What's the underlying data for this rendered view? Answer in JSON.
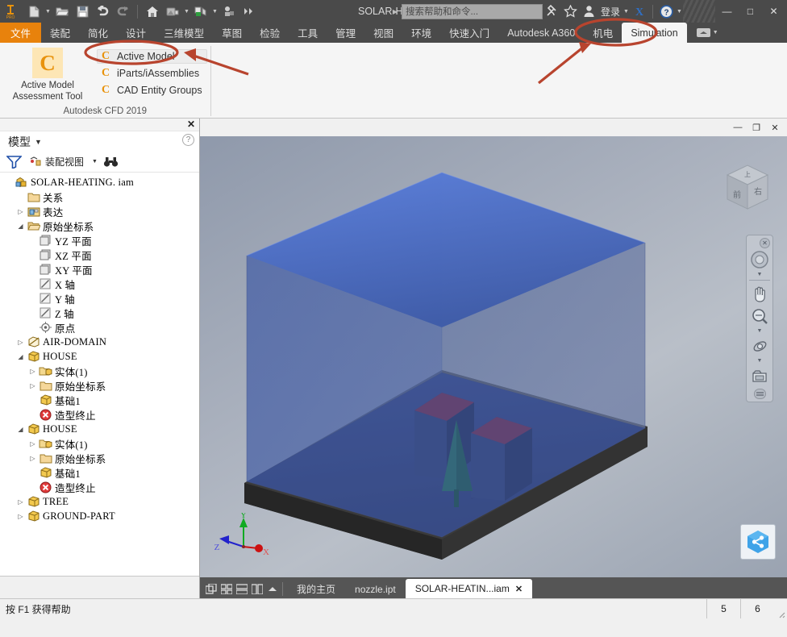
{
  "titlebar": {
    "doc_title": "SOLAR-HEAT...",
    "search_placeholder": "搜索帮助和命令...",
    "signin_label": "登录",
    "quick_access": [
      {
        "name": "new-file-icon",
        "label": "新建"
      },
      {
        "name": "open-file-icon",
        "label": "打开"
      },
      {
        "name": "save-icon",
        "label": "保存"
      },
      {
        "name": "undo-icon",
        "label": "放弃"
      },
      {
        "name": "redo-icon",
        "label": "重做"
      },
      {
        "name": "home-icon",
        "label": "主页"
      },
      {
        "name": "appearance-icon",
        "label": "外观"
      },
      {
        "name": "material-icon",
        "label": "材料"
      },
      {
        "name": "update-icon",
        "label": "更新"
      },
      {
        "name": "more-icon",
        "label": "更多"
      }
    ],
    "window_controls": {
      "minimize": "—",
      "maximize": "□",
      "close": "✕"
    },
    "exchange_icon": "X",
    "help_icon": "?"
  },
  "ribbon_tabs": [
    {
      "label": "文件",
      "state": "file"
    },
    {
      "label": "装配",
      "state": "normal"
    },
    {
      "label": "简化",
      "state": "normal"
    },
    {
      "label": "设计",
      "state": "normal"
    },
    {
      "label": "三维模型",
      "state": "normal"
    },
    {
      "label": "草图",
      "state": "normal"
    },
    {
      "label": "检验",
      "state": "normal"
    },
    {
      "label": "工具",
      "state": "normal"
    },
    {
      "label": "管理",
      "state": "normal"
    },
    {
      "label": "视图",
      "state": "normal"
    },
    {
      "label": "环境",
      "state": "normal"
    },
    {
      "label": "快速入门",
      "state": "normal"
    },
    {
      "label": "Autodesk A360",
      "state": "normal"
    },
    {
      "label": "机电",
      "state": "normal"
    },
    {
      "label": "Simulation",
      "state": "active"
    }
  ],
  "ribbon_panel": {
    "panel_label": "Autodesk CFD 2019",
    "big_button": {
      "icon_glyph": "C",
      "line1": "Active Model",
      "line2": "Assessment Tool"
    },
    "items": [
      {
        "icon_glyph": "C",
        "label": "Active Model",
        "highlighted": true
      },
      {
        "icon_glyph": "C",
        "label": "iParts/iAssemblies",
        "highlighted": false
      },
      {
        "icon_glyph": "C",
        "label": "CAD Entity Groups",
        "highlighted": false
      }
    ]
  },
  "browser": {
    "title": "模型",
    "close_icon": "✕",
    "help_icon": "?",
    "toolbar": {
      "filter_icon": "filter-icon",
      "view_label": "装配视图",
      "search_icon": "binoculars-icon"
    },
    "tree": [
      {
        "label": "SOLAR-HEATING. iam",
        "indent": 0,
        "expander": "none",
        "icon": "assembly"
      },
      {
        "label": "关系",
        "indent": 1,
        "expander": "none",
        "icon": "folder"
      },
      {
        "label": "表达",
        "indent": 1,
        "expander": "collapsed",
        "icon": "rep"
      },
      {
        "label": "原始坐标系",
        "indent": 1,
        "expander": "expanded",
        "icon": "folder-open"
      },
      {
        "label": "YZ 平面",
        "indent": 2,
        "expander": "none",
        "icon": "plane"
      },
      {
        "label": "XZ 平面",
        "indent": 2,
        "expander": "none",
        "icon": "plane"
      },
      {
        "label": "XY 平面",
        "indent": 2,
        "expander": "none",
        "icon": "plane"
      },
      {
        "label": "X 轴",
        "indent": 2,
        "expander": "none",
        "icon": "axis"
      },
      {
        "label": "Y 轴",
        "indent": 2,
        "expander": "none",
        "icon": "axis"
      },
      {
        "label": "Z 轴",
        "indent": 2,
        "expander": "none",
        "icon": "axis"
      },
      {
        "label": "原点",
        "indent": 2,
        "expander": "none",
        "icon": "point"
      },
      {
        "label": "AIR-DOMAIN",
        "indent": 1,
        "expander": "collapsed",
        "icon": "ghost-part"
      },
      {
        "label": "HOUSE",
        "indent": 1,
        "expander": "expanded",
        "icon": "part"
      },
      {
        "label": "实体(1)",
        "indent": 2,
        "expander": "collapsed",
        "icon": "solids"
      },
      {
        "label": "原始坐标系",
        "indent": 2,
        "expander": "collapsed",
        "icon": "folder"
      },
      {
        "label": "基础1",
        "indent": 2,
        "expander": "none",
        "icon": "part"
      },
      {
        "label": "造型终止",
        "indent": 2,
        "expander": "none",
        "icon": "end-of-part"
      },
      {
        "label": "HOUSE",
        "indent": 1,
        "expander": "expanded",
        "icon": "part"
      },
      {
        "label": "实体(1)",
        "indent": 2,
        "expander": "collapsed",
        "icon": "solids"
      },
      {
        "label": "原始坐标系",
        "indent": 2,
        "expander": "collapsed",
        "icon": "folder"
      },
      {
        "label": "基础1",
        "indent": 2,
        "expander": "none",
        "icon": "part"
      },
      {
        "label": "造型终止",
        "indent": 2,
        "expander": "none",
        "icon": "end-of-part"
      },
      {
        "label": "TREE",
        "indent": 1,
        "expander": "collapsed",
        "icon": "part"
      },
      {
        "label": "GROUND-PART",
        "indent": 1,
        "expander": "collapsed",
        "icon": "part"
      }
    ]
  },
  "viewport": {
    "window_controls": {
      "minimize": "—",
      "restore": "❐",
      "close": "✕"
    },
    "viewcube": {
      "front_face": "前",
      "right_face": "右",
      "top_face": "上"
    },
    "axis_indicator": {
      "x": "X",
      "y": "Y",
      "z": "Z",
      "x_color": "#cc1111",
      "y_color": "#11aa22",
      "z_color": "#2222cc"
    },
    "navbar": [
      {
        "name": "steering-wheel-icon"
      },
      {
        "name": "pan-hand-icon"
      },
      {
        "name": "zoom-magnifier-icon"
      },
      {
        "name": "orbit-icon"
      },
      {
        "name": "look-at-icon"
      }
    ],
    "a360_icon": "share-icon",
    "model_colors": {
      "air_domain": "#4a63a8",
      "air_domain_top": "#4f72c9",
      "roof": "#6e3558",
      "house_wall": "#34437a",
      "tree": "#2b6b64",
      "ground_slab": "#3a3a3a"
    }
  },
  "doc_tabs": {
    "layout_icons": [
      "cascade-icon",
      "tile-icon",
      "horizontal-icon",
      "vertical-icon",
      "collapse-icon"
    ],
    "tabs": [
      {
        "label": "我的主页",
        "active": false,
        "closable": false
      },
      {
        "label": "nozzle.ipt",
        "active": false,
        "closable": false
      },
      {
        "label": "SOLAR-HEATIN...iam",
        "active": true,
        "closable": true,
        "close_icon": "✕"
      }
    ]
  },
  "statusbar": {
    "message": "按 F1 获得帮助",
    "cell1": "5",
    "cell2": "6"
  },
  "annotations": {
    "color": "#b8442e",
    "ellipse_simulation": "Simulation",
    "ellipse_active_model": "Active Model"
  }
}
